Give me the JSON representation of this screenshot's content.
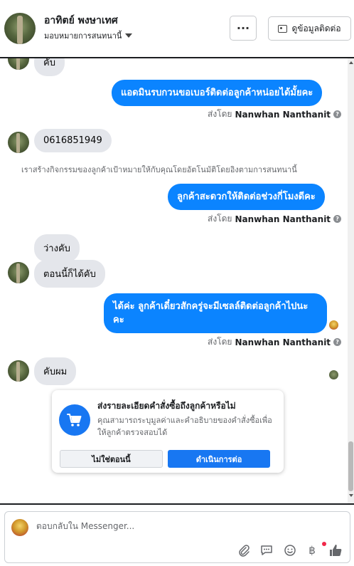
{
  "header": {
    "contact_name": "อาทิตย์ พงษาเทศ",
    "assignment": "มอบหมายการสนทนานี้",
    "more_label": "···",
    "detail_label": "ดูข้อมูลติดต่อ"
  },
  "messages": {
    "partial_top": "คับ",
    "out_1": "แอดมินรบกวนขอเบอร์ติดต่อลูกค้าหน่อยได้มั้ยคะ",
    "sent_by_prefix": "ส่งโดย",
    "sent_by_name": "Nanwhan Nanthanit",
    "in_phone": "0616851949",
    "system_note": "เราสร้างกิจกรรมของลูกค้าเป้าหมายให้กับคุณโดยอัตโนมัติโดยอิงตามการสนทนานี้",
    "out_2": "ลูกค้าสะดวกให้ติดต่อช่วงกี่โมงดีคะ",
    "in_free": "ว่างคับ",
    "in_now": "ตอนนี้ก็ได้คับ",
    "out_3": "ได้ค่ะ ลูกค้าเดี๋ยวสักครู่จะมีเซลล์ติดต่อลูกค้าไปนะคะ",
    "in_yes": "คับผม"
  },
  "order_prompt": {
    "title": "ส่งรายละเอียดคำสั่งซื้อถึงลูกค้าหรือไม่",
    "description": "คุณสามารถระบุมูลค่าและคำอธิบายของคำสั่งซื้อเพื่อให้ลูกค้าตรวจสอบได้",
    "decline_label": "ไม่ใช่ตอนนี้",
    "continue_label": "ดำเนินการต่อ"
  },
  "composer": {
    "placeholder": "ตอบกลับใน Messenger...",
    "currency_symbol": "฿"
  },
  "icons": {
    "more": "more-horizontal-icon",
    "contact_card": "contact-card-icon",
    "info": "info-icon",
    "cart": "shopping-cart-icon",
    "attach": "paperclip-icon",
    "saved_replies": "chat-bubble-icon",
    "emoji": "smiley-icon",
    "payment": "baht-icon",
    "like": "thumbs-up-icon"
  },
  "colors": {
    "outgoing_bubble": "#0b84ff",
    "incoming_bubble": "#e4e6eb",
    "primary_button": "#1877f2",
    "notification_dot": "#f02849"
  }
}
